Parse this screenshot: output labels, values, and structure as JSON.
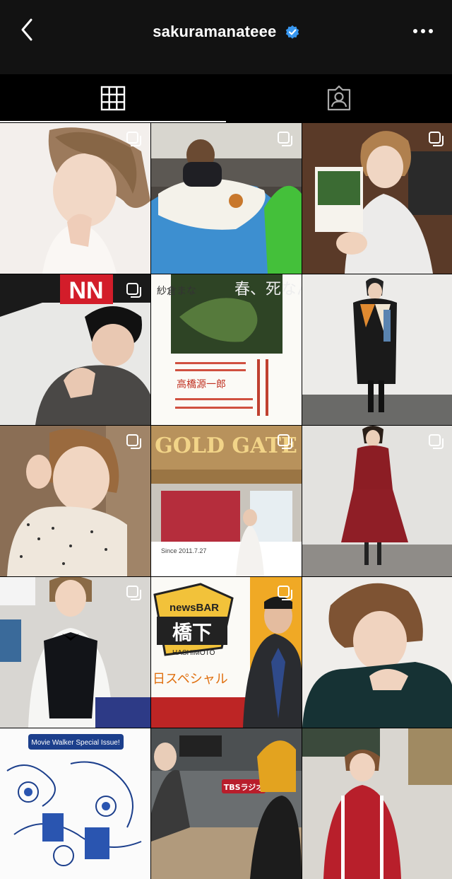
{
  "header": {
    "username": "sakuramanateee"
  },
  "icons": {
    "back": "chevron-left-icon",
    "verified": "verified-badge-icon",
    "more": "more-horizontal-icon",
    "grid_tab": "grid-icon",
    "tagged_tab": "tagged-person-icon",
    "multi": "multiple-photos-icon"
  },
  "colors": {
    "background": "#000000",
    "header": "#121212",
    "verified": "#3897f0",
    "tab_active": "#f5f5f5"
  },
  "tabs": [
    {
      "name": "posts-grid",
      "active": true
    },
    {
      "name": "tagged",
      "active": false
    }
  ],
  "posts": [
    {
      "row": 1,
      "col": 1,
      "multi": true
    },
    {
      "row": 1,
      "col": 2,
      "multi": true
    },
    {
      "row": 1,
      "col": 3,
      "multi": true
    },
    {
      "row": 2,
      "col": 1,
      "multi": true,
      "text": "NN"
    },
    {
      "row": 2,
      "col": 2,
      "multi": false,
      "text_top": "春、死なん",
      "text_author": "紗倉まな",
      "text_body": "高橋源一郎"
    },
    {
      "row": 2,
      "col": 3,
      "multi": false
    },
    {
      "row": 3,
      "col": 1,
      "multi": true
    },
    {
      "row": 3,
      "col": 2,
      "multi": true,
      "text_sign": "GOLD GATE",
      "text_sub": "Since 2011.7.27"
    },
    {
      "row": 3,
      "col": 3,
      "multi": true
    },
    {
      "row": 4,
      "col": 1,
      "multi": true
    },
    {
      "row": 4,
      "col": 2,
      "multi": true,
      "text_logo": "newsBAR",
      "text_kanji": "橋下",
      "text_roman": "HASHIMOTO",
      "text_special": "日スペシャル"
    },
    {
      "row": 4,
      "col": 3,
      "multi": false
    },
    {
      "row": 5,
      "col": 1,
      "multi": false,
      "text_banner": "Movie Walker Special Issue!"
    },
    {
      "row": 5,
      "col": 2,
      "multi": false,
      "text_logo": "TBSラジオ"
    },
    {
      "row": 5,
      "col": 3,
      "multi": false
    }
  ]
}
